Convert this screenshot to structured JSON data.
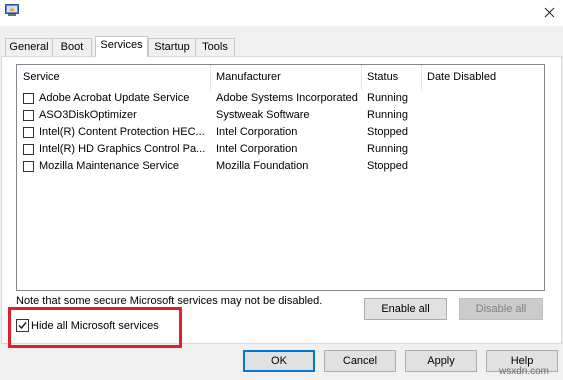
{
  "window": {
    "close_glyph": "✕"
  },
  "tabs": [
    {
      "label": "General",
      "active": false
    },
    {
      "label": "Boot",
      "active": false
    },
    {
      "label": "Services",
      "active": true
    },
    {
      "label": "Startup",
      "active": false
    },
    {
      "label": "Tools",
      "active": false
    }
  ],
  "services_table": {
    "headers": [
      "Service",
      "Manufacturer",
      "Status",
      "Date Disabled"
    ],
    "rows": [
      {
        "service": "Adobe Acrobat Update Service",
        "manufacturer": "Adobe Systems Incorporated",
        "status": "Running",
        "date_disabled": "",
        "checked": false
      },
      {
        "service": "ASO3DiskOptimizer",
        "manufacturer": "Systweak Software",
        "status": "Running",
        "date_disabled": "",
        "checked": false
      },
      {
        "service": "Intel(R) Content Protection HEC...",
        "manufacturer": "Intel Corporation",
        "status": "Stopped",
        "date_disabled": "",
        "checked": false
      },
      {
        "service": "Intel(R) HD Graphics Control Pa...",
        "manufacturer": "Intel Corporation",
        "status": "Running",
        "date_disabled": "",
        "checked": false
      },
      {
        "service": "Mozilla Maintenance Service",
        "manufacturer": "Mozilla Foundation",
        "status": "Stopped",
        "date_disabled": "",
        "checked": false
      }
    ]
  },
  "note": "Note that some secure Microsoft services may not be disabled.",
  "enable_all_label": "Enable all",
  "disable_all_label": "Disable all",
  "hide_ms_label": "Hide all Microsoft services",
  "hide_ms_checked": true,
  "footer": {
    "ok": "OK",
    "cancel": "Cancel",
    "apply": "Apply",
    "help": "Help"
  },
  "watermark": "wsxdn.com",
  "colors": {
    "highlight": "#e0202c",
    "accent": "#0078d7"
  }
}
